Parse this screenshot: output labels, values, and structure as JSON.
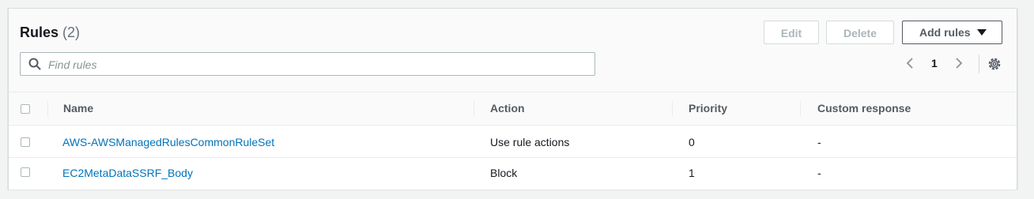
{
  "header": {
    "title": "Rules",
    "count": "(2)",
    "edit_label": "Edit",
    "delete_label": "Delete",
    "add_label": "Add rules"
  },
  "search": {
    "placeholder": "Find rules",
    "value": ""
  },
  "pagination": {
    "current_page": "1"
  },
  "table": {
    "columns": [
      "Name",
      "Action",
      "Priority",
      "Custom response"
    ],
    "rows": [
      {
        "name": "AWS-AWSManagedRulesCommonRuleSet",
        "action": "Use rule actions",
        "priority": "0",
        "custom_response": "-"
      },
      {
        "name": "EC2MetaDataSSRF_Body",
        "action": "Block",
        "priority": "1",
        "custom_response": "-"
      }
    ]
  },
  "icons": {
    "search": "search-icon",
    "prev": "chevron-left-icon",
    "next": "chevron-right-icon",
    "settings": "gear-icon",
    "add_dropdown": "caret-down-icon"
  },
  "colors": {
    "link": "#0073bb",
    "disabled_text": "#aab7b8",
    "header_bg": "#fafafa"
  }
}
